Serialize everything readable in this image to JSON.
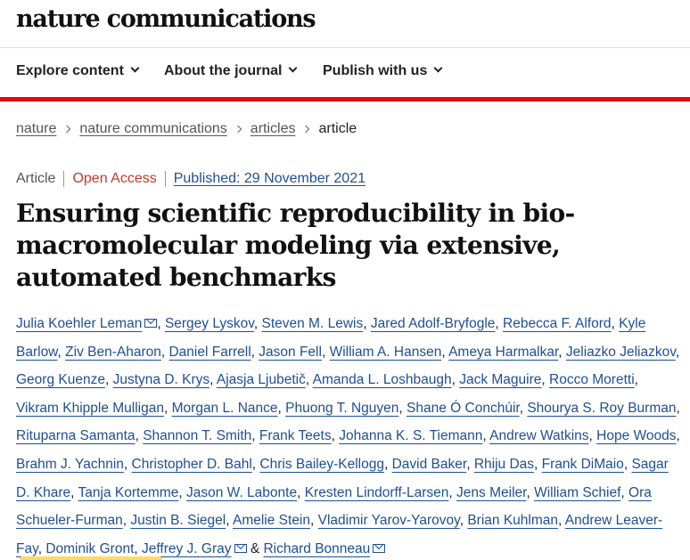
{
  "brand": {
    "name": "nature communications"
  },
  "nav": {
    "items": [
      {
        "label": "Explore content"
      },
      {
        "label": "About the journal"
      },
      {
        "label": "Publish with us"
      }
    ]
  },
  "breadcrumb": {
    "items": [
      "nature",
      "nature communications",
      "articles"
    ],
    "current": "article"
  },
  "meta": {
    "type": "Article",
    "access": "Open Access",
    "published": "Published: 29 November 2021"
  },
  "title": "Ensuring scientific reproducibility in bio-macromolecular modeling via extensive, automated benchmarks",
  "authors": [
    {
      "name": "Julia Koehler Leman",
      "mail": true
    },
    {
      "name": "Sergey Lyskov"
    },
    {
      "name": "Steven M. Lewis"
    },
    {
      "name": "Jared Adolf-Bryfogle"
    },
    {
      "name": "Rebecca F. Alford"
    },
    {
      "name": "Kyle Barlow"
    },
    {
      "name": "Ziv Ben-Aharon"
    },
    {
      "name": "Daniel Farrell"
    },
    {
      "name": "Jason Fell"
    },
    {
      "name": "William A. Hansen"
    },
    {
      "name": "Ameya Harmalkar"
    },
    {
      "name": "Jeliazko Jeliazkov"
    },
    {
      "name": "Georg Kuenze"
    },
    {
      "name": "Justyna D. Krys"
    },
    {
      "name": "Ajasja Ljubetič"
    },
    {
      "name": "Amanda L. Loshbaugh"
    },
    {
      "name": "Jack Maguire"
    },
    {
      "name": "Rocco Moretti"
    },
    {
      "name": "Vikram Khipple Mulligan"
    },
    {
      "name": "Morgan L. Nance"
    },
    {
      "name": "Phuong T. Nguyen"
    },
    {
      "name": "Shane Ó Conchúir"
    },
    {
      "name": "Shourya S. Roy Burman"
    },
    {
      "name": "Rituparna Samanta"
    },
    {
      "name": "Shannon T. Smith"
    },
    {
      "name": "Frank Teets"
    },
    {
      "name": "Johanna K. S. Tiemann"
    },
    {
      "name": "Andrew Watkins"
    },
    {
      "name": "Hope Woods"
    },
    {
      "name": "Brahm J. Yachnin"
    },
    {
      "name": "Christopher D. Bahl"
    },
    {
      "name": "Chris Bailey-Kellogg"
    },
    {
      "name": "David Baker"
    },
    {
      "name": "Rhiju Das"
    },
    {
      "name": "Frank DiMaio"
    },
    {
      "name": "Sagar D. Khare"
    },
    {
      "name": "Tanja Kortemme"
    },
    {
      "name": "Jason W. Labonte"
    },
    {
      "name": "Kresten Lindorff-Larsen"
    },
    {
      "name": "Jens Meiler"
    },
    {
      "name": "William Schief"
    },
    {
      "name": "Ora Schueler-Furman"
    },
    {
      "name": "Justin B. Siegel"
    },
    {
      "name": "Amelie Stein"
    },
    {
      "name": "Vladimir Yarov-Yarovoy"
    },
    {
      "name": "Brian Kuhlman"
    },
    {
      "name": "Andrew Leaver-Fay"
    },
    {
      "name": "Dominik Gront"
    },
    {
      "name": "Jeffrey J. Gray",
      "mail": true
    },
    {
      "name": "Richard Bonneau",
      "mail": true
    }
  ],
  "authors_conjunction": "&",
  "colors": {
    "accent_red": "#e4050d",
    "link_blue": "#1f4e96",
    "open_access": "#c0392b"
  }
}
